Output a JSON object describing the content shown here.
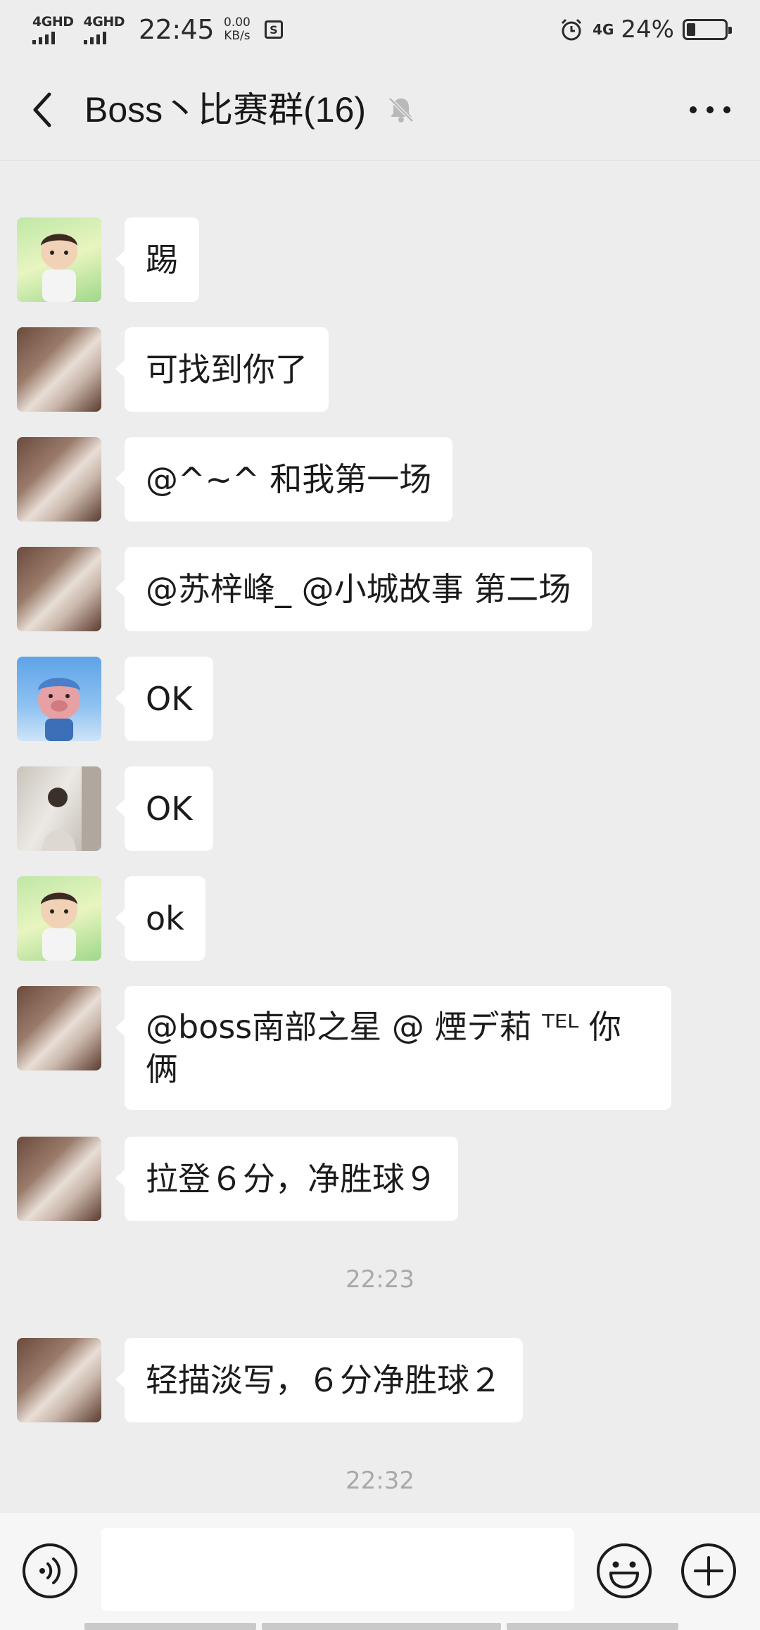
{
  "status_bar": {
    "sim1_label": "4GHD",
    "sim2_label": "4GHD",
    "time": "22:45",
    "speed_value": "0.00",
    "speed_unit": "KB/s",
    "s_icon_label": "S",
    "network_label": "4G",
    "battery_percent": "24%",
    "battery_level": 0.24
  },
  "header": {
    "title": "Boss丶比赛群(16)",
    "muted": true
  },
  "messages": [
    {
      "avatar": "girl-avatar",
      "text": "@"
    },
    {
      "avatar": "boy-avatar",
      "text": "踢"
    },
    {
      "avatar": "girl-avatar",
      "text": "可找到你了"
    },
    {
      "avatar": "girl-avatar",
      "text": "@^~^ 和我第一场"
    },
    {
      "avatar": "girl-avatar",
      "text": "@苏梓峰_ @小城故事  第二场"
    },
    {
      "avatar": "pig-avatar",
      "text": "OK"
    },
    {
      "avatar": "man-avatar",
      "text": "OK"
    },
    {
      "avatar": "boy-avatar",
      "text": "ok"
    },
    {
      "avatar": "girl-avatar",
      "text": "@boss南部之星 @ 煙デ萂 ᵀᴱᴸ 你俩"
    },
    {
      "avatar": "girl-avatar",
      "text": "拉登６分，净胜球９"
    },
    {
      "avatar": "girl-avatar",
      "text": "轻描淡写，６分净胜球２"
    }
  ],
  "timestamps": [
    "22:23",
    "22:32"
  ],
  "input_bar": {
    "placeholder": "",
    "icons": [
      "voice-icon",
      "emoji-icon",
      "plus-icon"
    ]
  }
}
